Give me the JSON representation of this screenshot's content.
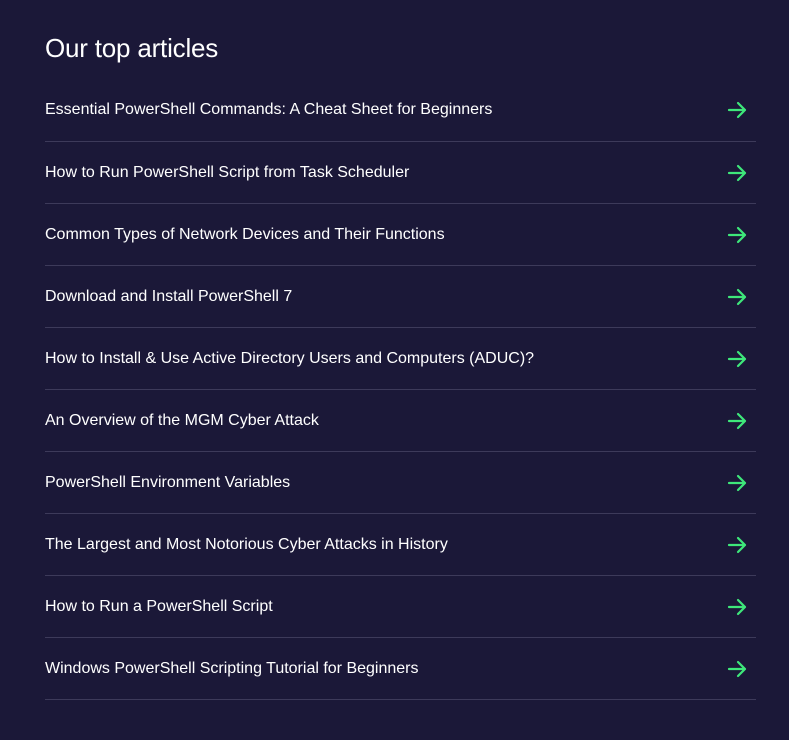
{
  "section": {
    "title": "Our top articles"
  },
  "accent": "#3ee87a",
  "icon": "arrow-right-icon",
  "articles": [
    {
      "label": "Essential PowerShell Commands: A Cheat Sheet for Beginners"
    },
    {
      "label": "How to Run PowerShell Script from Task Scheduler"
    },
    {
      "label": "Common Types of Network Devices and Their Functions"
    },
    {
      "label": "Download and Install PowerShell 7"
    },
    {
      "label": "How to Install & Use Active Directory Users and Computers (ADUC)?"
    },
    {
      "label": "An Overview of the MGM Cyber Attack"
    },
    {
      "label": "PowerShell Environment Variables"
    },
    {
      "label": "The Largest and Most Notorious Cyber Attacks in History"
    },
    {
      "label": "How to Run a PowerShell Script"
    },
    {
      "label": "Windows PowerShell Scripting Tutorial for Beginners"
    }
  ]
}
